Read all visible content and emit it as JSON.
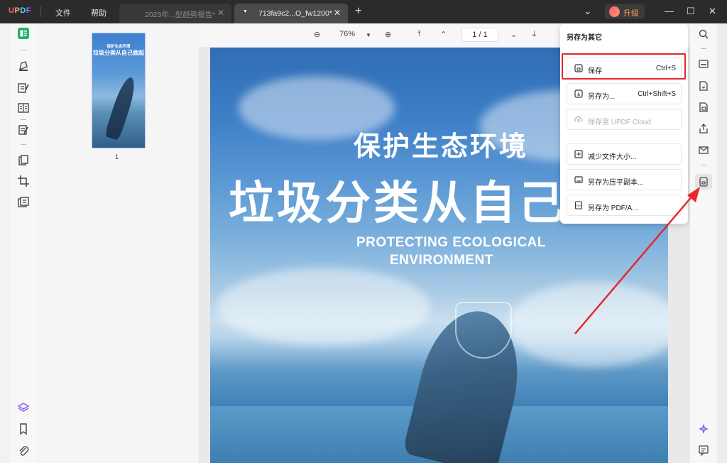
{
  "app": {
    "logo": "UPDF",
    "menu": [
      "文件",
      "帮助"
    ],
    "upgrade_label": "升级"
  },
  "tabs": [
    {
      "title": "2023年...型趋势报告*",
      "active": false
    },
    {
      "title": "713fa9c2...O_fw1200*",
      "active": true
    }
  ],
  "toolbar": {
    "zoom": "76%",
    "page_indicator": "1 / 1"
  },
  "thumbnail": {
    "page_number": "1",
    "title_small": "保护生态环境",
    "title_large": "垃圾分类从自己做起"
  },
  "page": {
    "title_line1": "保护生态环境",
    "title_line2": "垃圾分类从自己",
    "english_line1": "PROTECTING ECOLOGICAL",
    "english_line2": "ENVIRONMENT"
  },
  "save_menu": {
    "title": "另存为其它",
    "items": [
      {
        "label": "保存",
        "shortcut": "Ctrl+S",
        "icon": "save-icon",
        "disabled": false
      },
      {
        "label": "另存为...",
        "shortcut": "Ctrl+Shift+S",
        "icon": "save-as-icon",
        "disabled": false
      },
      {
        "label": "保存至 UPDF Cloud",
        "shortcut": "",
        "icon": "cloud-upload-icon",
        "disabled": true
      },
      {
        "label": "减少文件大小...",
        "shortcut": "",
        "icon": "compress-icon",
        "disabled": false
      },
      {
        "label": "另存为压平副本...",
        "shortcut": "",
        "icon": "flatten-icon",
        "disabled": false
      },
      {
        "label": "另存为 PDF/A...",
        "shortcut": "",
        "icon": "pdfa-icon",
        "disabled": false
      }
    ]
  },
  "colors": {
    "titlebar": "#2b2b2b",
    "highlight": "#e8262b",
    "accent_green": "#20b26b",
    "accent_purple": "#8b5cf6"
  }
}
